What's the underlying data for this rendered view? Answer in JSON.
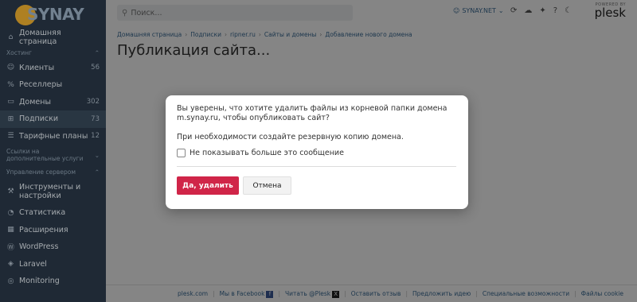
{
  "brand": {
    "logo_text": "SYNAY"
  },
  "sidebar": {
    "items": [
      {
        "label": "Домашняя страница",
        "count": "",
        "icon": "home-icon"
      },
      {
        "label": "Клиенты",
        "count": "56",
        "icon": "user-icon"
      },
      {
        "label": "Реселлеры",
        "count": "",
        "icon": "percent-icon"
      },
      {
        "label": "Домены",
        "count": "302",
        "icon": "monitor-icon"
      },
      {
        "label": "Подписки",
        "count": "73",
        "icon": "grid-icon"
      },
      {
        "label": "Тарифные планы",
        "count": "12",
        "icon": "list-icon"
      },
      {
        "label": "Инструменты и настройки",
        "count": "",
        "icon": "wrench-icon"
      },
      {
        "label": "Статистика",
        "count": "",
        "icon": "chart-icon"
      },
      {
        "label": "Расширения",
        "count": "",
        "icon": "puzzle-icon"
      },
      {
        "label": "WordPress",
        "count": "",
        "icon": "wordpress-icon"
      },
      {
        "label": "Laravel",
        "count": "",
        "icon": "laravel-icon"
      },
      {
        "label": "Monitoring",
        "count": "",
        "icon": "monitoring-icon"
      }
    ],
    "sections": {
      "hosting": "Хостинг",
      "links": "Ссылки на дополнительные услуги",
      "server": "Управление сервером"
    }
  },
  "topbar": {
    "search_placeholder": "Поиск...",
    "account": "SYNAY.NET",
    "plesk_powered": "POWERED BY",
    "plesk_name": "plesk"
  },
  "breadcrumb": [
    "Домашняя страница",
    "Подписки",
    "ripner.ru",
    "Сайты и домены",
    "Добавление нового домена"
  ],
  "page": {
    "title": "Публикация сайта..."
  },
  "dialog": {
    "question": "Вы уверены, что хотите удалить файлы из корневой папки домена m.synay.ru, чтобы опубликовать сайт?",
    "note": "При необходимости создайте резервную копию домена.",
    "checkbox_label": "Не показывать больше это сообщение",
    "checkbox_checked": false,
    "confirm_label": "Да, удалить",
    "cancel_label": "Отмена"
  },
  "footer": {
    "links": [
      "plesk.com",
      "Мы в Facebook",
      "Читать @Plesk",
      "Оставить отзыв",
      "Предложить идею",
      "Специальные возможности",
      "Файлы cookie"
    ]
  },
  "colors": {
    "sidebar": "#2b3a4a",
    "danger": "#d02548",
    "link": "#3b6c96"
  }
}
